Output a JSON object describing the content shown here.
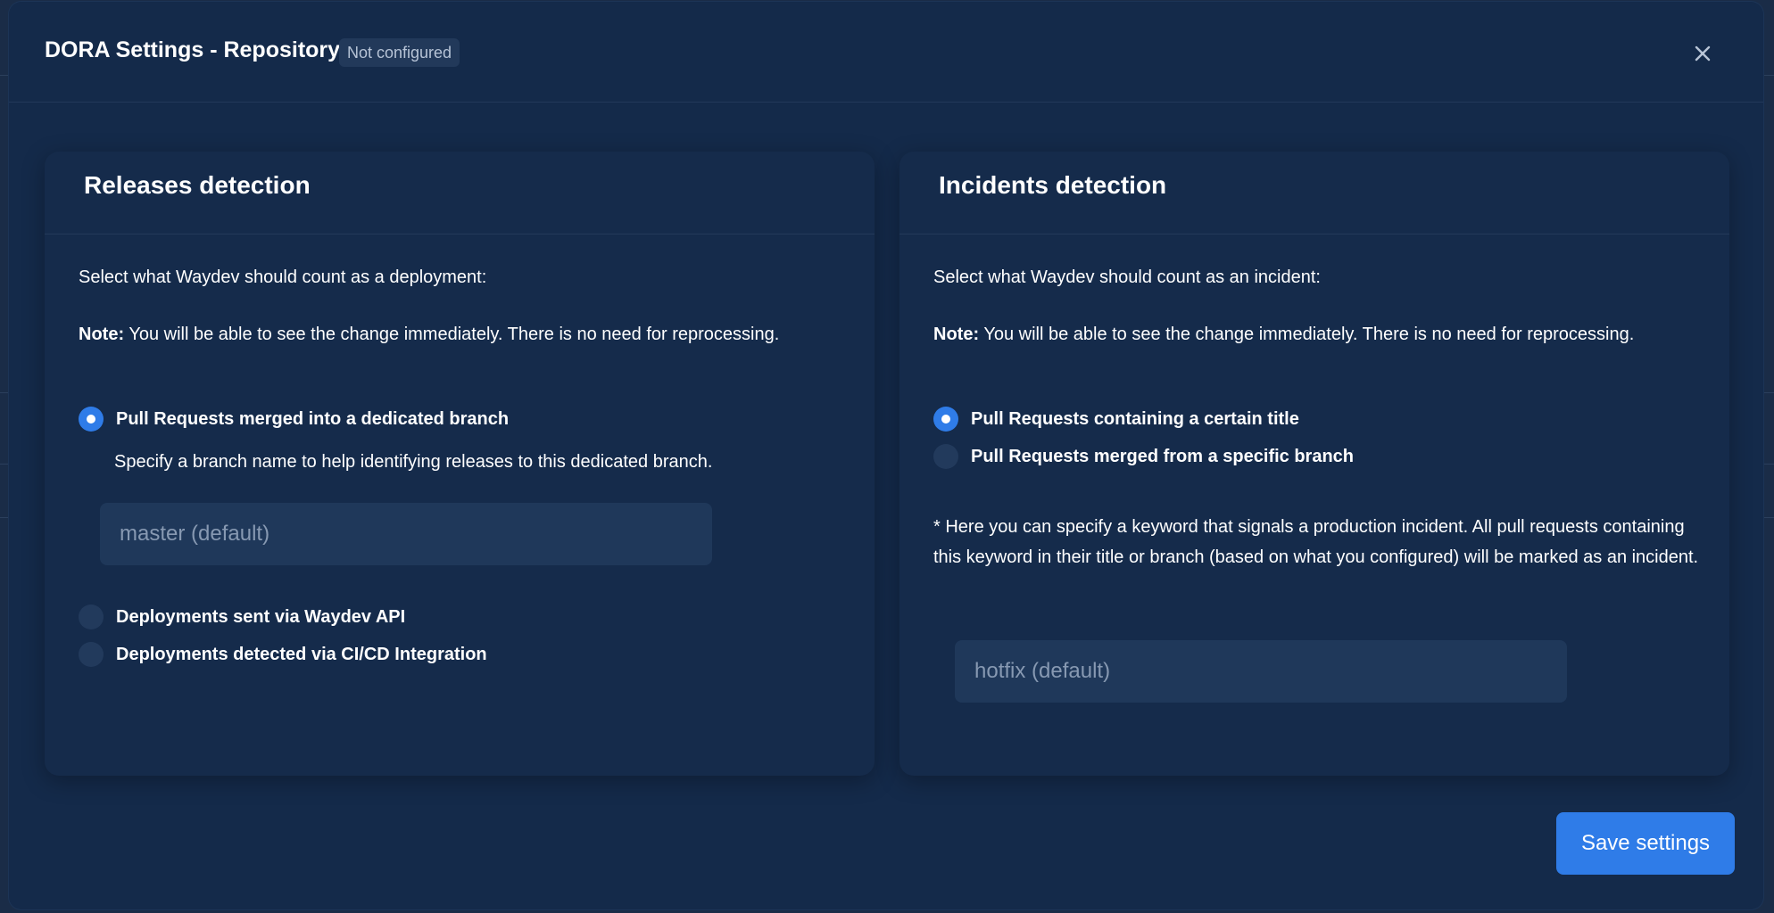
{
  "modal": {
    "title": "DORA Settings - Repository",
    "status_badge": "Not configured",
    "close_icon": "close-icon"
  },
  "releases": {
    "title": "Releases detection",
    "instruction": "Select what Waydev should count as a deployment:",
    "note_label": "Note:",
    "note_text": "You will be able to see the change immediately. There is no need for reprocessing.",
    "options": [
      {
        "label": "Pull Requests merged into a dedicated branch",
        "selected": true
      },
      {
        "label": "Deployments sent via Waydev API",
        "selected": false
      },
      {
        "label": "Deployments detected via CI/CD Integration",
        "selected": false
      }
    ],
    "branch_help": "Specify a branch name to help identifying releases to this dedicated branch.",
    "branch_input": {
      "value": "",
      "placeholder": "master (default)"
    }
  },
  "incidents": {
    "title": "Incidents detection",
    "instruction": "Select what Waydev should count as an incident:",
    "note_label": "Note:",
    "note_text": "You will be able to see the change immediately. There is no need for reprocessing.",
    "options": [
      {
        "label": "Pull Requests containing a certain title",
        "selected": true
      },
      {
        "label": "Pull Requests merged from a specific branch",
        "selected": false
      }
    ],
    "keyword_help": "* Here you can specify a keyword that signals a production incident. All pull requests containing this keyword in their title or branch (based on what you configured) will be marked as an incident.",
    "keyword_input": {
      "value": "",
      "placeholder": "hotfix (default)"
    }
  },
  "footer": {
    "save_label": "Save settings"
  },
  "colors": {
    "modal_bg": "#142a4a",
    "accent": "#2f7ce8",
    "input_bg": "#1f385a",
    "badge_bg": "#22395a"
  }
}
